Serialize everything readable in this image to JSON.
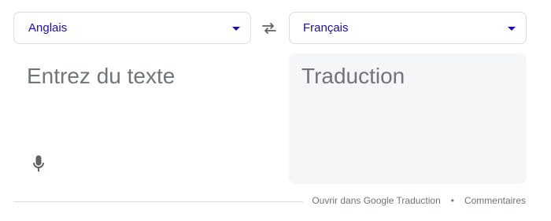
{
  "source_language": {
    "label": "Anglais"
  },
  "target_language": {
    "label": "Français"
  },
  "source": {
    "placeholder": "Entrez du texte"
  },
  "target": {
    "placeholder": "Traduction"
  },
  "footer": {
    "open_link": "Ouvrir dans Google Traduction",
    "separator": "•",
    "feedback_link": "Commentaires"
  },
  "colors": {
    "accent": "#1a0dab",
    "muted_text": "#70757a",
    "border": "#dadce0",
    "target_bg": "#f5f6f8",
    "icon": "#5f6368"
  },
  "icons": {
    "swap": "swap-arrows-icon",
    "mic": "microphone-icon",
    "dropdown": "caret-down-icon"
  }
}
